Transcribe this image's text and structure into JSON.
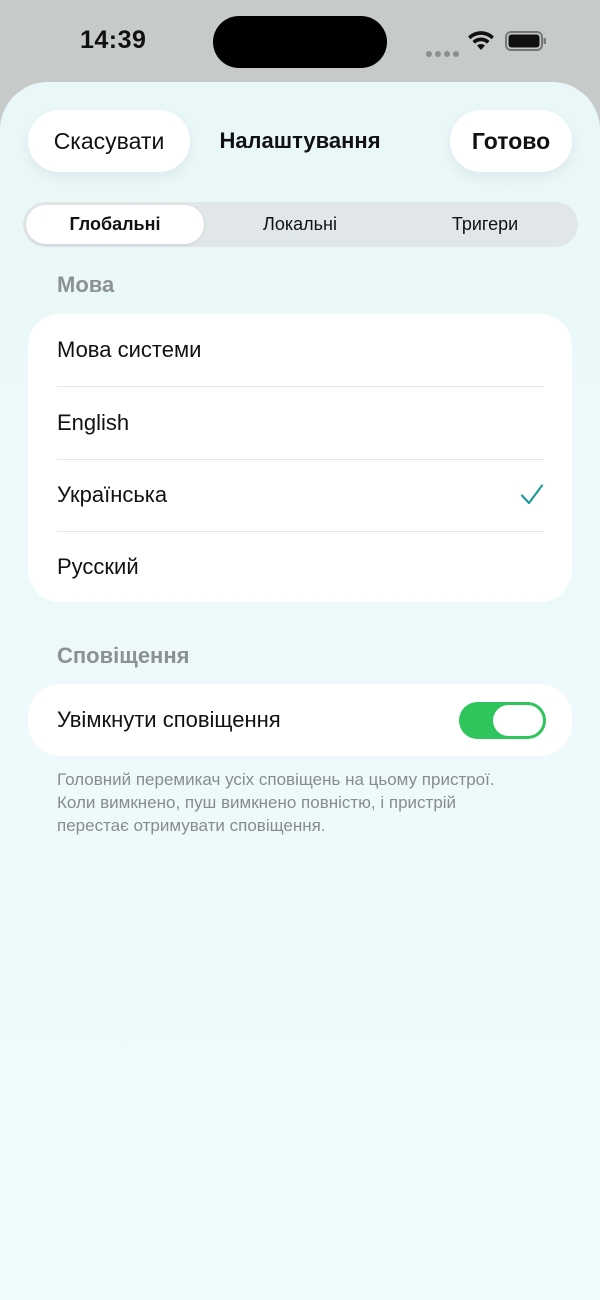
{
  "status_bar": {
    "time": "14:39"
  },
  "header": {
    "cancel_label": "Скасувати",
    "title": "Налаштування",
    "done_label": "Готово"
  },
  "tabs": [
    {
      "label": "Глобальні",
      "selected": true
    },
    {
      "label": "Локальні",
      "selected": false
    },
    {
      "label": "Тригери",
      "selected": false
    }
  ],
  "language_section": {
    "header": "Мова",
    "items": [
      {
        "label": "Мова системи",
        "selected": false
      },
      {
        "label": "English",
        "selected": false
      },
      {
        "label": "Українська",
        "selected": true
      },
      {
        "label": "Русский",
        "selected": false
      }
    ],
    "check_icon": "checkmark-icon"
  },
  "notifications_section": {
    "header": "Сповіщення",
    "toggle_label": "Увімкнути сповіщення",
    "toggle_on": true,
    "note": "Головний перемикач усіх сповіщень на цьому пристрої. Коли вимкнено, пуш вимкнено повністю, і пристрій перестає отримувати сповіщення."
  },
  "colors": {
    "accent": "#1e9c9a",
    "toggle_on": "#2fc55c",
    "sheet_background": "#eaf7f8",
    "section_header": "#8b9293"
  }
}
